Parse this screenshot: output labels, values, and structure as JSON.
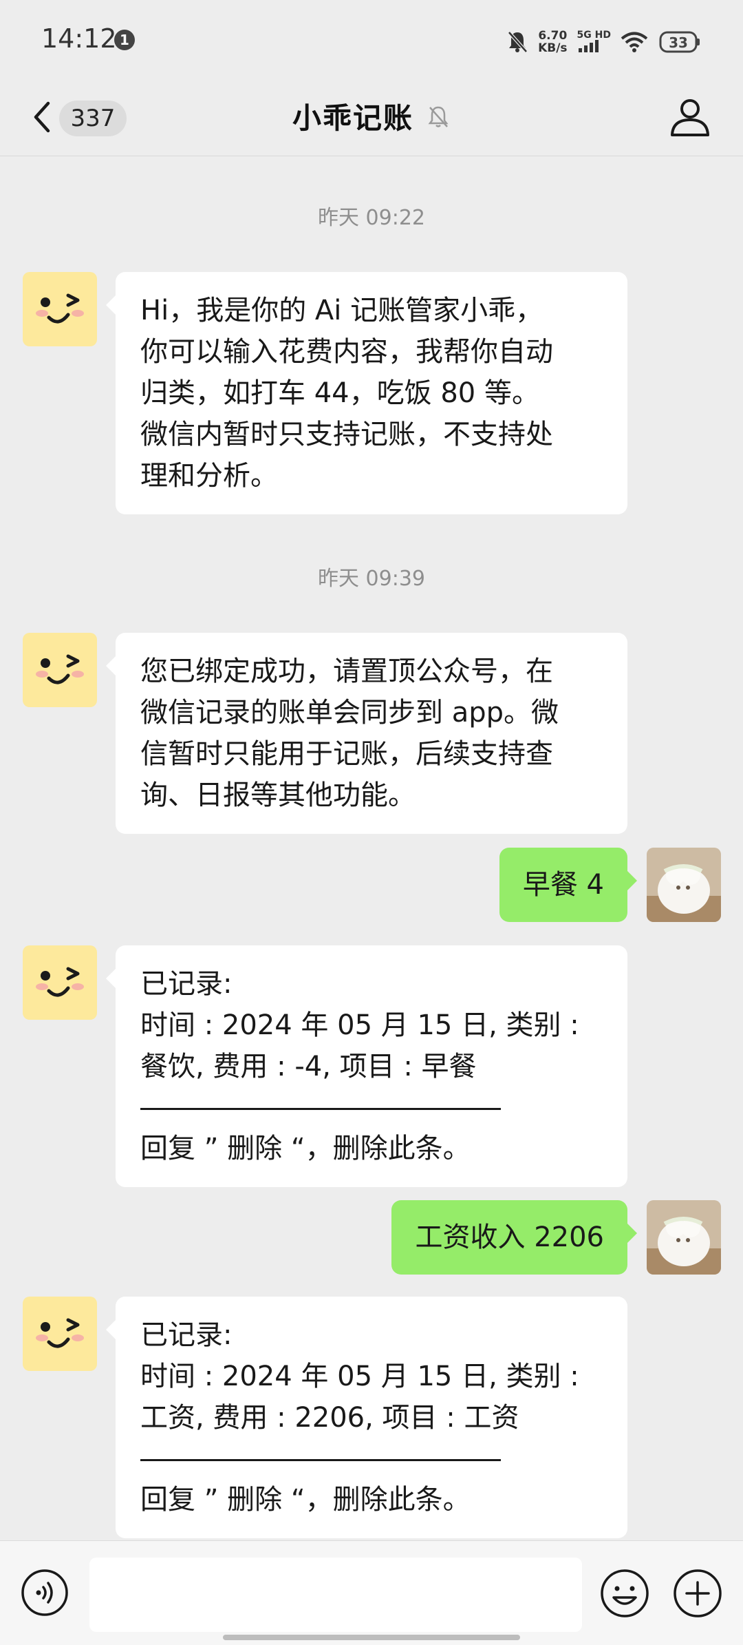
{
  "status_bar": {
    "time": "14:12",
    "notification_count": "1",
    "net_speed_value": "6.70",
    "net_speed_unit": "KB/s",
    "network_top": "5G HD",
    "network_bottom": "",
    "battery_icon": "battery-icon"
  },
  "header": {
    "back_icon": "chevron-left-icon",
    "unread_count": "337",
    "title": "小乖记账",
    "mute_icon": "bell-muted-icon",
    "profile_icon": "person-icon"
  },
  "messages": [
    {
      "type": "timestamp",
      "text": "昨天 09:22"
    },
    {
      "type": "incoming",
      "lines": [
        "Hi，我是你的 Ai 记账管家小乖，",
        "你可以输入花费内容，我帮你自动",
        "归类，如打车 44，吃饭 80 等。",
        "微信内暂时只支持记账，不支持处",
        "理和分析。"
      ]
    },
    {
      "type": "timestamp",
      "text": "昨天 09:39"
    },
    {
      "type": "incoming",
      "lines": [
        "您已绑定成功，请置顶公众号，在",
        "微信记录的账单会同步到 app。微",
        "信暂时只能用于记账，后续支持查",
        "询、日报等其他功能。"
      ]
    },
    {
      "type": "outgoing",
      "text": "早餐 4"
    },
    {
      "type": "incoming",
      "lines": [
        "已记录:",
        "时间 : 2024 年 05 月 15 日, 类别 :",
        "餐饮, 费用 : -4, 项目 : 早餐"
      ],
      "footer": "回复 ” 删除 “，删除此条。"
    },
    {
      "type": "outgoing",
      "text": "工资收入 2206"
    },
    {
      "type": "incoming",
      "lines": [
        "已记录:",
        "时间 : 2024 年 05 月 15 日, 类别 :",
        "工资, 费用 : 2206, 项目 : 工资"
      ],
      "footer": "回复 ” 删除 “，删除此条。"
    }
  ],
  "input_bar": {
    "voice_icon": "voice-icon",
    "input_value": "",
    "emoji_icon": "emoji-icon",
    "plus_icon": "plus-icon"
  },
  "colors": {
    "background": "#ededed",
    "incoming_bubble": "#ffffff",
    "outgoing_bubble": "#95ec69",
    "bot_avatar": "#fde99c"
  }
}
